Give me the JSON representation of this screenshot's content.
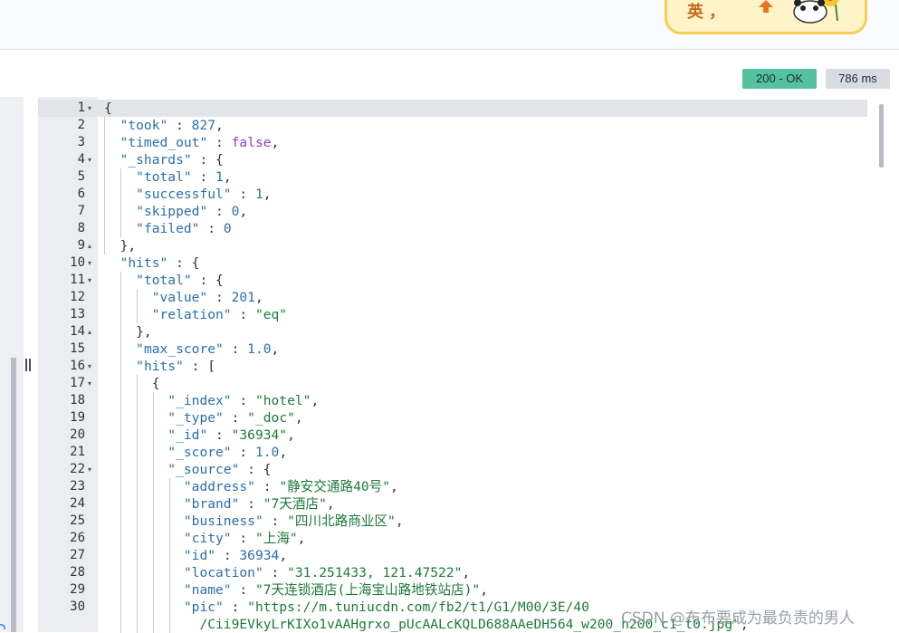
{
  "banner": {
    "text": "英，",
    "icons": [
      "arrow-up-icon",
      "panda-sticker-icon"
    ]
  },
  "status": {
    "code": "200 - OK",
    "time": "786 ms"
  },
  "editor": {
    "lines": [
      {
        "n": "1",
        "fold": "▾",
        "html": "<span class=\"p\">{</span>"
      },
      {
        "n": "2",
        "fold": "",
        "html": "  <span class=\"k\">\"took\"</span> : <span class=\"n\">827</span>,"
      },
      {
        "n": "3",
        "fold": "",
        "html": "  <span class=\"k\">\"timed_out\"</span> : <span class=\"b\">false</span>,"
      },
      {
        "n": "4",
        "fold": "▾",
        "html": "  <span class=\"k\">\"_shards\"</span> : {"
      },
      {
        "n": "5",
        "fold": "",
        "html": "    <span class=\"k\">\"total\"</span> : <span class=\"n\">1</span>,"
      },
      {
        "n": "6",
        "fold": "",
        "html": "    <span class=\"k\">\"successful\"</span> : <span class=\"n\">1</span>,"
      },
      {
        "n": "7",
        "fold": "",
        "html": "    <span class=\"k\">\"skipped\"</span> : <span class=\"n\">0</span>,"
      },
      {
        "n": "8",
        "fold": "",
        "html": "    <span class=\"k\">\"failed\"</span> : <span class=\"n\">0</span>"
      },
      {
        "n": "9",
        "fold": "▴",
        "html": "  },"
      },
      {
        "n": "10",
        "fold": "▾",
        "html": "  <span class=\"k\">\"hits\"</span> : {"
      },
      {
        "n": "11",
        "fold": "▾",
        "html": "    <span class=\"k\">\"total\"</span> : {"
      },
      {
        "n": "12",
        "fold": "",
        "html": "      <span class=\"k\">\"value\"</span> : <span class=\"n\">201</span>,"
      },
      {
        "n": "13",
        "fold": "",
        "html": "      <span class=\"k\">\"relation\"</span> : <span class=\"s\">\"eq\"</span>"
      },
      {
        "n": "14",
        "fold": "▴",
        "html": "    },"
      },
      {
        "n": "15",
        "fold": "",
        "html": "    <span class=\"k\">\"max_score\"</span> : <span class=\"n\">1.0</span>,"
      },
      {
        "n": "16",
        "fold": "▾",
        "html": "    <span class=\"k\">\"hits\"</span> : ["
      },
      {
        "n": "17",
        "fold": "▾",
        "html": "      {"
      },
      {
        "n": "18",
        "fold": "",
        "html": "        <span class=\"k\">\"_index\"</span> : <span class=\"s\">\"hotel\"</span>,"
      },
      {
        "n": "19",
        "fold": "",
        "html": "        <span class=\"k\">\"_type\"</span> : <span class=\"s\">\"_doc\"</span>,"
      },
      {
        "n": "20",
        "fold": "",
        "html": "        <span class=\"k\">\"_id\"</span> : <span class=\"s\">\"36934\"</span>,"
      },
      {
        "n": "21",
        "fold": "",
        "html": "        <span class=\"k\">\"_score\"</span> : <span class=\"n\">1.0</span>,"
      },
      {
        "n": "22",
        "fold": "▾",
        "html": "        <span class=\"k\">\"_source\"</span> : {"
      },
      {
        "n": "23",
        "fold": "",
        "html": "          <span class=\"k\">\"address\"</span> : <span class=\"s\">\"静安交通路40号\"</span>,"
      },
      {
        "n": "24",
        "fold": "",
        "html": "          <span class=\"k\">\"brand\"</span> : <span class=\"s\">\"7天酒店\"</span>,"
      },
      {
        "n": "25",
        "fold": "",
        "html": "          <span class=\"k\">\"business\"</span> : <span class=\"s\">\"四川北路商业区\"</span>,"
      },
      {
        "n": "26",
        "fold": "",
        "html": "          <span class=\"k\">\"city\"</span> : <span class=\"s\">\"上海\"</span>,"
      },
      {
        "n": "27",
        "fold": "",
        "html": "          <span class=\"k\">\"id\"</span> : <span class=\"n\">36934</span>,"
      },
      {
        "n": "28",
        "fold": "",
        "html": "          <span class=\"k\">\"location\"</span> : <span class=\"s\">\"31.251433, 121.47522\"</span>,"
      },
      {
        "n": "29",
        "fold": "",
        "html": "          <span class=\"k\">\"name\"</span> : <span class=\"s\">\"7天连锁酒店(上海宝山路地铁站店)\"</span>,"
      },
      {
        "n": "30",
        "fold": "",
        "html": "          <span class=\"k\">\"pic\"</span> : <span class=\"s\">\"https://m.tuniucdn.com/fb2/t1/G1/M00/3E/40</span>"
      },
      {
        "n": "",
        "fold": "",
        "html": "            <span class=\"s\">/Cii9EVkyLrKIXo1vAAHgrxo_pUcAALcKQLD688AAeDH564_w200_h200_c1_t0.jpg\"</span>,"
      }
    ]
  },
  "watermark": "CSDN @布布要成为最负责的男人"
}
